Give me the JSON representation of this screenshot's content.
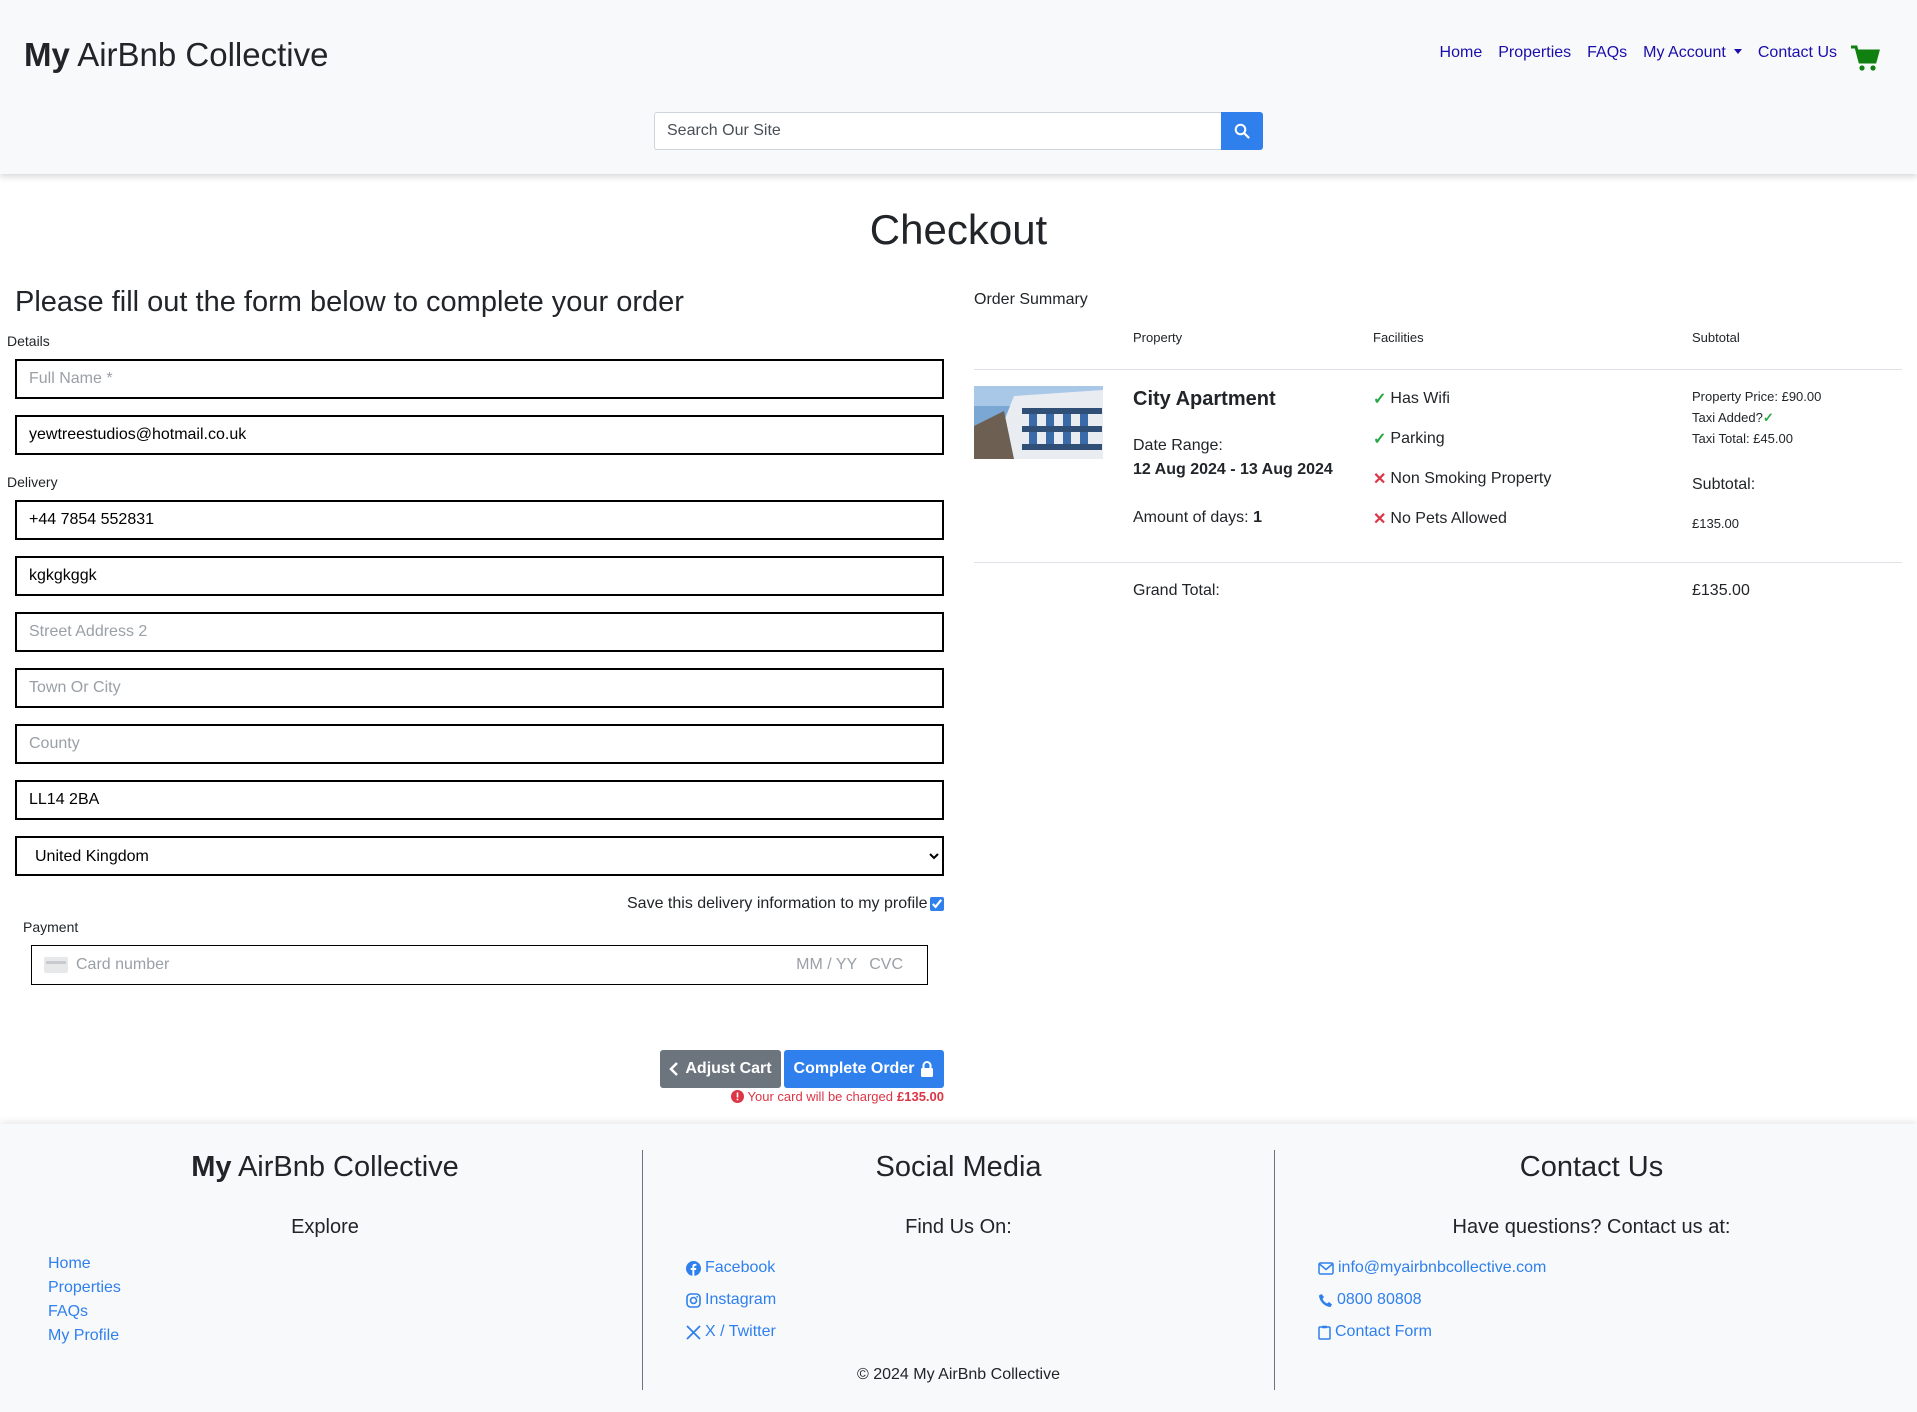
{
  "header": {
    "brand_bold": "My",
    "brand_rest": " AirBnb Collective",
    "nav": {
      "home": "Home",
      "properties": "Properties",
      "faqs": "FAQs",
      "account": "My Account",
      "contact": "Contact Us"
    },
    "search_placeholder": "Search Our Site"
  },
  "page_title": "Checkout",
  "form": {
    "heading": "Please fill out the form below to complete your order",
    "details_label": "Details",
    "delivery_label": "Delivery",
    "payment_label": "Payment",
    "full_name_placeholder": "Full Name *",
    "email_value": "yewtreestudios@hotmail.co.uk",
    "phone_value": "+44 7854 552831",
    "street1_value": "kgkgkggk",
    "street2_placeholder": "Street Address 2",
    "town_placeholder": "Town Or City",
    "county_placeholder": "County",
    "postcode_value": "LL14 2BA",
    "country_value": "United Kingdom",
    "save_info_label": "Save this delivery information to my profile",
    "card_placeholder": "Card number",
    "card_expiry_placeholder": "MM / YY",
    "card_cvc_placeholder": "CVC",
    "adjust_cart_label": "Adjust Cart",
    "complete_order_label": "Complete Order",
    "charge_notice": "Your card will be charged",
    "charge_amount": "£135.00"
  },
  "order_summary": {
    "title": "Order Summary",
    "columns": [
      "Property",
      "Facilities",
      "Subtotal"
    ],
    "property_name": "City Apartment",
    "date_range_label": "Date Range:",
    "date_range_value": "12 Aug 2024 - 13 Aug 2024",
    "days_label": "Amount of days:",
    "days_value": "1",
    "facilities": [
      {
        "label": "Has Wifi",
        "status": "yes"
      },
      {
        "label": "Parking",
        "status": "yes"
      },
      {
        "label": "Non Smoking Property",
        "status": "no"
      },
      {
        "label": "No Pets Allowed",
        "status": "no"
      }
    ],
    "property_price": "Property Price: £90.00",
    "taxi_added": "Taxi Added?",
    "taxi_total": "Taxi Total: £45.00",
    "subtotal_label": "Subtotal:",
    "subtotal_value": "£135.00",
    "grand_total_label": "Grand Total:",
    "grand_total_value": "£135.00"
  },
  "footer": {
    "brand_bold": "My",
    "brand_rest": " AirBnb Collective",
    "explore_title": "Explore",
    "explore_links": [
      "Home",
      "Properties",
      "FAQs",
      "My Profile"
    ],
    "social_title": "Social Media",
    "social_subtitle": "Find Us On:",
    "social_links": [
      "Facebook",
      "Instagram",
      "X / Twitter"
    ],
    "contact_title": "Contact Us",
    "contact_subtitle": "Have questions? Contact us at:",
    "contact_email": "info@myairbnbcollective.com",
    "contact_phone": "0800 80808",
    "contact_form": "Contact Form",
    "copyright": "© 2024 My AirBnb Collective"
  },
  "colors": {
    "accent": "#2f80ed",
    "nav_link": "#1a0dab",
    "cart": "#108010",
    "danger": "#dc3545",
    "success": "#28a745"
  }
}
